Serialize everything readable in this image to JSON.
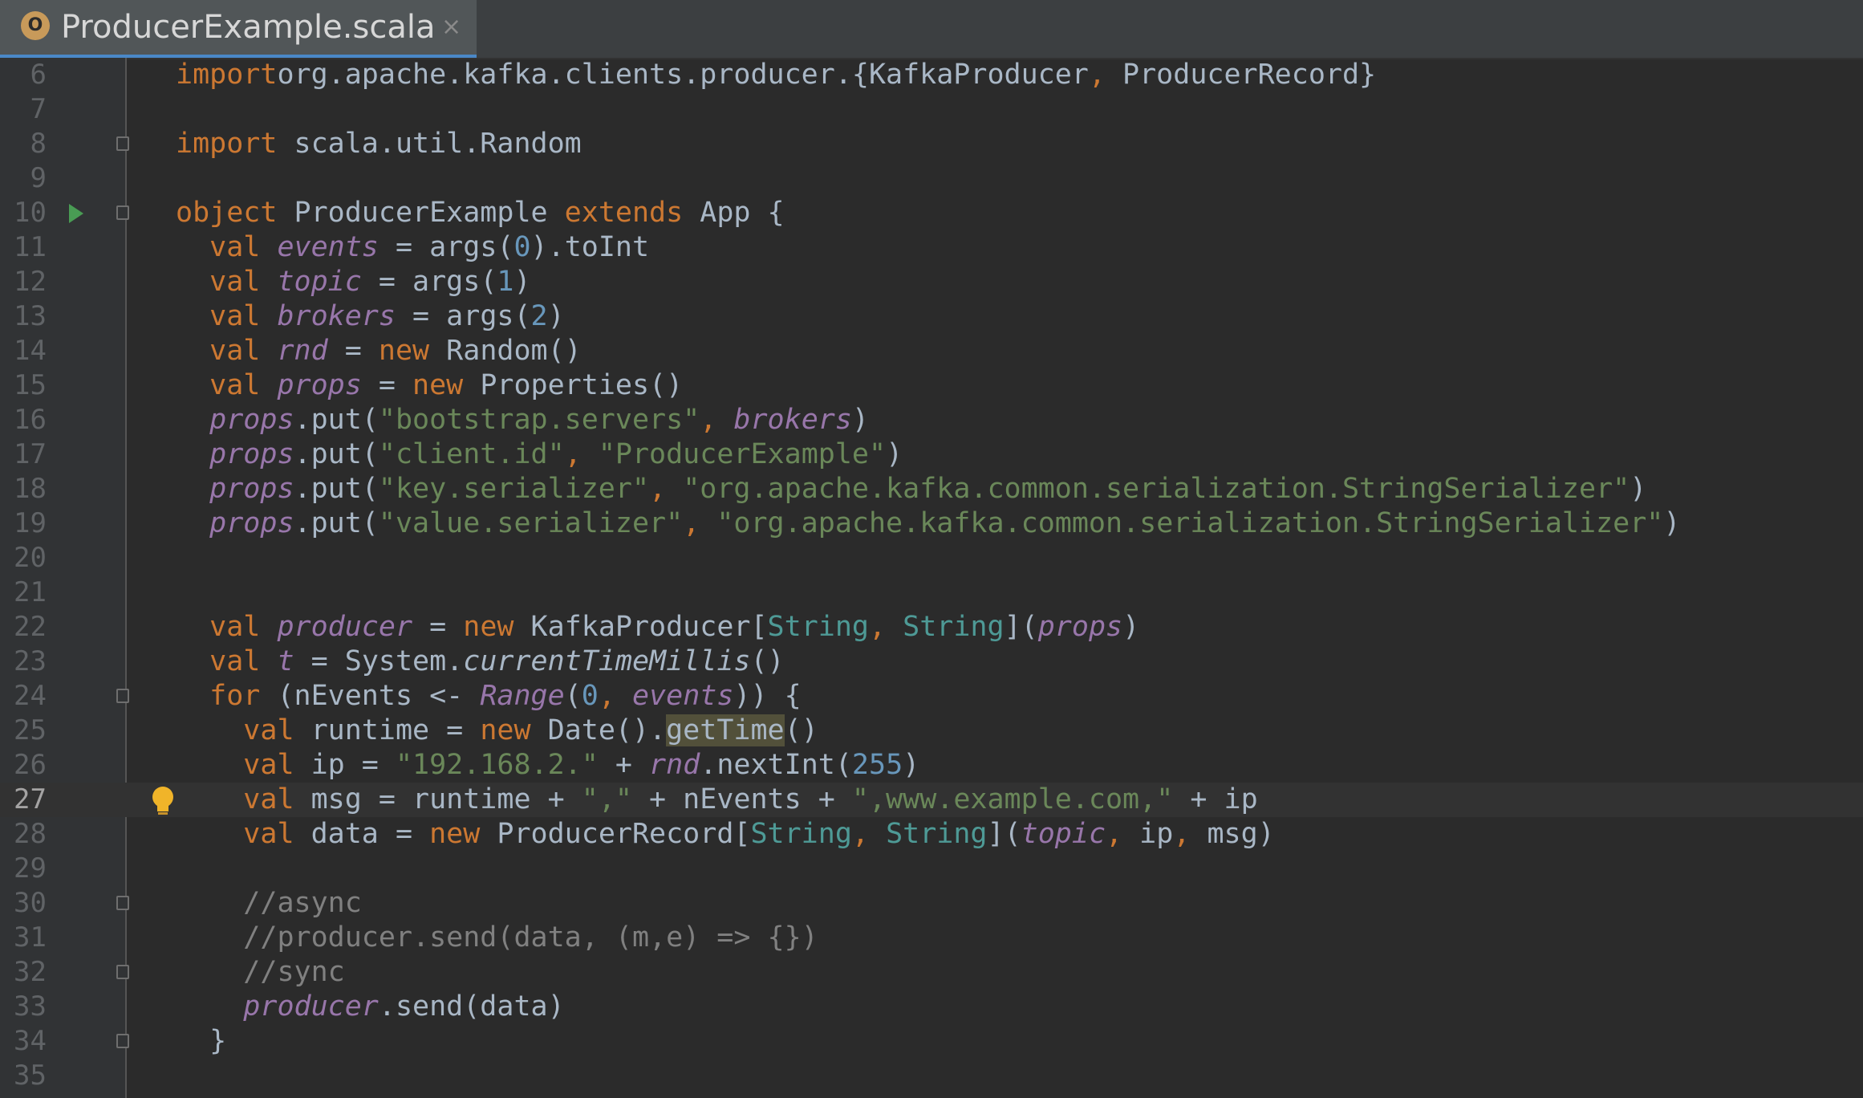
{
  "tab": {
    "file_icon": "scala-object-icon",
    "icon_letter": "O",
    "title": "ProducerExample.scala",
    "close_glyph": "×"
  },
  "colors": {
    "background": "#2b2b2b",
    "gutter": "#313335",
    "keyword": "#cc7832",
    "string": "#6a8759",
    "number": "#6897bb",
    "field": "#9876aa",
    "type_param": "#4e9a96",
    "comment": "#808080",
    "run_marker": "#499c54",
    "bulb": "#f0b429"
  },
  "editor": {
    "current_line": 27,
    "lines": [
      {
        "n": "6",
        "t": [
          [
            "kw",
            "import"
          ],
          [
            "",
            "org.apache.kafka.clients.producer.{KafkaProducer"
          ],
          [
            "kw",
            ","
          ],
          [
            "",
            " ProducerRecord}"
          ]
        ]
      },
      {
        "n": "7",
        "t": []
      },
      {
        "n": "8",
        "t": [
          [
            "kw",
            "import"
          ],
          [
            "",
            " scala.util.Random"
          ]
        ]
      },
      {
        "n": "9",
        "t": []
      },
      {
        "n": "10",
        "t": [
          [
            "kw",
            "object"
          ],
          [
            "",
            " ProducerExample "
          ],
          [
            "kw",
            "extends"
          ],
          [
            "",
            " App {"
          ]
        ]
      },
      {
        "n": "11",
        "t": [
          [
            "",
            "  "
          ],
          [
            "kw",
            "val"
          ],
          [
            "",
            " "
          ],
          [
            "fld",
            "events"
          ],
          [
            "",
            " = args("
          ],
          [
            "num",
            "0"
          ],
          [
            "",
            ").toInt"
          ]
        ]
      },
      {
        "n": "12",
        "t": [
          [
            "",
            "  "
          ],
          [
            "kw",
            "val"
          ],
          [
            "",
            " "
          ],
          [
            "fld",
            "topic"
          ],
          [
            "",
            " = args("
          ],
          [
            "num",
            "1"
          ],
          [
            "",
            ")"
          ]
        ]
      },
      {
        "n": "13",
        "t": [
          [
            "",
            "  "
          ],
          [
            "kw",
            "val"
          ],
          [
            "",
            " "
          ],
          [
            "fld",
            "brokers"
          ],
          [
            "",
            " = args("
          ],
          [
            "num",
            "2"
          ],
          [
            "",
            ")"
          ]
        ]
      },
      {
        "n": "14",
        "t": [
          [
            "",
            "  "
          ],
          [
            "kw",
            "val"
          ],
          [
            "",
            " "
          ],
          [
            "fld",
            "rnd"
          ],
          [
            "",
            " = "
          ],
          [
            "kw",
            "new"
          ],
          [
            "",
            " Random()"
          ]
        ]
      },
      {
        "n": "15",
        "t": [
          [
            "",
            "  "
          ],
          [
            "kw",
            "val"
          ],
          [
            "",
            " "
          ],
          [
            "fld",
            "props"
          ],
          [
            "",
            " = "
          ],
          [
            "kw",
            "new"
          ],
          [
            "",
            " Properties()"
          ]
        ]
      },
      {
        "n": "16",
        "t": [
          [
            "",
            "  "
          ],
          [
            "fld",
            "props"
          ],
          [
            "",
            ".put("
          ],
          [
            "str",
            "\"bootstrap.servers\""
          ],
          [
            "kw",
            ","
          ],
          [
            "",
            " "
          ],
          [
            "fld",
            "brokers"
          ],
          [
            "",
            ")"
          ]
        ]
      },
      {
        "n": "17",
        "t": [
          [
            "",
            "  "
          ],
          [
            "fld",
            "props"
          ],
          [
            "",
            ".put("
          ],
          [
            "str",
            "\"client.id\""
          ],
          [
            "kw",
            ","
          ],
          [
            "",
            " "
          ],
          [
            "str",
            "\"ProducerExample\""
          ],
          [
            "",
            ")"
          ]
        ]
      },
      {
        "n": "18",
        "t": [
          [
            "",
            "  "
          ],
          [
            "fld",
            "props"
          ],
          [
            "",
            ".put("
          ],
          [
            "str",
            "\"key.serializer\""
          ],
          [
            "kw",
            ","
          ],
          [
            "",
            " "
          ],
          [
            "str",
            "\"org.apache.kafka.common.serialization.StringSerializer\""
          ],
          [
            "",
            ")"
          ]
        ]
      },
      {
        "n": "19",
        "t": [
          [
            "",
            "  "
          ],
          [
            "fld",
            "props"
          ],
          [
            "",
            ".put("
          ],
          [
            "str",
            "\"value.serializer\""
          ],
          [
            "kw",
            ","
          ],
          [
            "",
            " "
          ],
          [
            "str",
            "\"org.apache.kafka.common.serialization.StringSerializer\""
          ],
          [
            "",
            ")"
          ]
        ]
      },
      {
        "n": "20",
        "t": []
      },
      {
        "n": "21",
        "t": []
      },
      {
        "n": "22",
        "t": [
          [
            "",
            "  "
          ],
          [
            "kw",
            "val"
          ],
          [
            "",
            " "
          ],
          [
            "fld",
            "producer"
          ],
          [
            "",
            " = "
          ],
          [
            "kw",
            "new"
          ],
          [
            "",
            " KafkaProducer["
          ],
          [
            "typ",
            "String"
          ],
          [
            "kw",
            ","
          ],
          [
            "",
            " "
          ],
          [
            "typ",
            "String"
          ],
          [
            "",
            "]("
          ],
          [
            "fld",
            "props"
          ],
          [
            "",
            ")"
          ]
        ]
      },
      {
        "n": "23",
        "t": [
          [
            "",
            "  "
          ],
          [
            "kw",
            "val"
          ],
          [
            "",
            " "
          ],
          [
            "fld",
            "t"
          ],
          [
            "",
            " = System."
          ],
          [
            "it",
            "currentTimeMillis"
          ],
          [
            "",
            "()"
          ]
        ]
      },
      {
        "n": "24",
        "t": [
          [
            "",
            "  "
          ],
          [
            "kw",
            "for"
          ],
          [
            "",
            " (nEvents <- "
          ],
          [
            "fld",
            "Range"
          ],
          [
            "",
            "("
          ],
          [
            "num",
            "0"
          ],
          [
            "kw",
            ","
          ],
          [
            "",
            " "
          ],
          [
            "fld",
            "events"
          ],
          [
            "",
            ")) {"
          ]
        ]
      },
      {
        "n": "25",
        "t": [
          [
            "",
            "    "
          ],
          [
            "kw",
            "val"
          ],
          [
            "",
            " runtime = "
          ],
          [
            "kw",
            "new"
          ],
          [
            "",
            " Date()."
          ],
          [
            "hl",
            "getTime"
          ],
          [
            "",
            "()"
          ]
        ]
      },
      {
        "n": "26",
        "t": [
          [
            "",
            "    "
          ],
          [
            "kw",
            "val"
          ],
          [
            "",
            " ip = "
          ],
          [
            "str",
            "\"192.168.2.\""
          ],
          [
            "",
            " + "
          ],
          [
            "fld",
            "rnd"
          ],
          [
            "",
            ".nextInt("
          ],
          [
            "num",
            "255"
          ],
          [
            "",
            ")"
          ]
        ]
      },
      {
        "n": "27",
        "t": [
          [
            "",
            "    "
          ],
          [
            "kw",
            "val"
          ],
          [
            "",
            " msg = runtime + "
          ],
          [
            "str",
            "\",\""
          ],
          [
            "",
            " + nEvents + "
          ],
          [
            "str",
            "\",www.example.com,\""
          ],
          [
            "",
            " + ip"
          ]
        ]
      },
      {
        "n": "28",
        "t": [
          [
            "",
            "    "
          ],
          [
            "kw",
            "val"
          ],
          [
            "",
            " data = "
          ],
          [
            "kw",
            "new"
          ],
          [
            "",
            " ProducerRecord["
          ],
          [
            "typ",
            "String"
          ],
          [
            "kw",
            ","
          ],
          [
            "",
            " "
          ],
          [
            "typ",
            "String"
          ],
          [
            "",
            "]("
          ],
          [
            "fld",
            "topic"
          ],
          [
            "kw",
            ","
          ],
          [
            "",
            " ip"
          ],
          [
            "kw",
            ","
          ],
          [
            "",
            " msg)"
          ]
        ]
      },
      {
        "n": "29",
        "t": []
      },
      {
        "n": "30",
        "t": [
          [
            "",
            "    "
          ],
          [
            "cmt",
            "//async"
          ]
        ]
      },
      {
        "n": "31",
        "t": [
          [
            "",
            "    "
          ],
          [
            "cmt",
            "//producer.send(data, (m,e) => {})"
          ]
        ]
      },
      {
        "n": "32",
        "t": [
          [
            "",
            "    "
          ],
          [
            "cmt",
            "//sync"
          ]
        ]
      },
      {
        "n": "33",
        "t": [
          [
            "",
            "    "
          ],
          [
            "fld",
            "producer"
          ],
          [
            "",
            ".send(data)"
          ]
        ]
      },
      {
        "n": "34",
        "t": [
          [
            "",
            "  }"
          ]
        ]
      },
      {
        "n": "35",
        "t": []
      }
    ]
  },
  "gutter": {
    "run_marker_icon": "run-arrow-icon",
    "intention_icon": "lightbulb-icon",
    "fold_icon": "fold-marker-icon"
  }
}
